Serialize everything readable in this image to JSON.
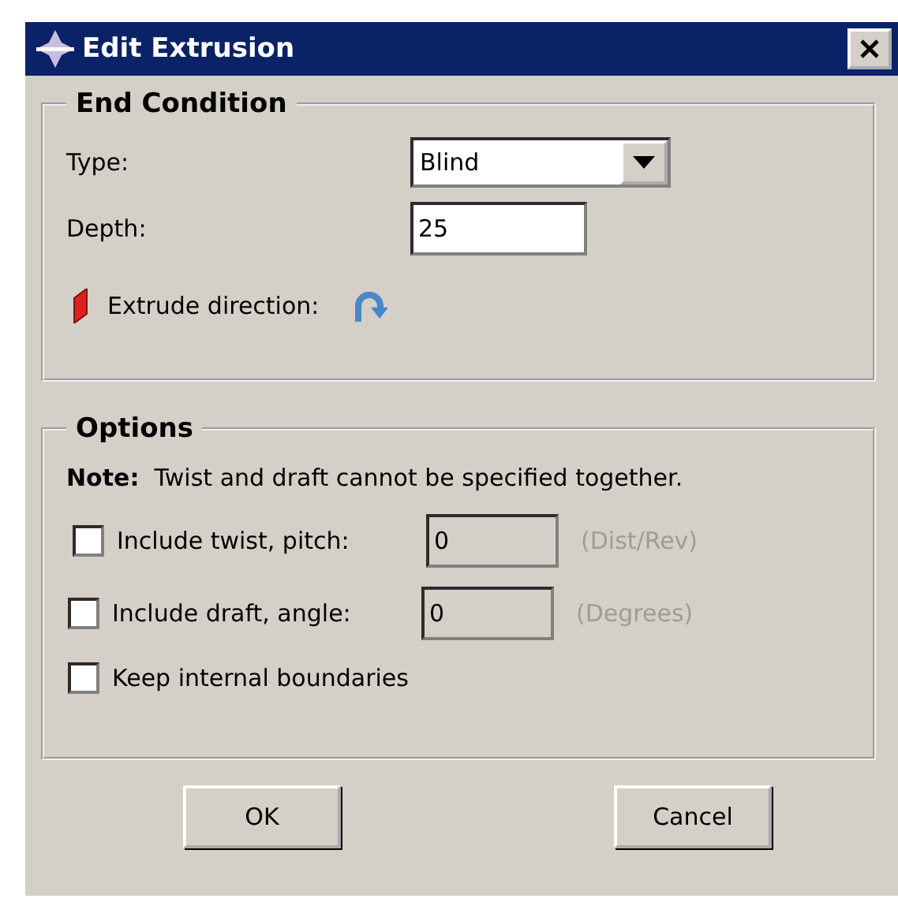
{
  "window": {
    "title": "Edit Extrusion"
  },
  "end_condition": {
    "title": "End Condition",
    "type": {
      "label": "Type:",
      "value": "Blind"
    },
    "depth": {
      "label": "Depth:",
      "value": "25"
    },
    "direction": {
      "label": "Extrude direction:"
    }
  },
  "options": {
    "title": "Options",
    "note": "**Note:**  Twist and draft cannot be specified together.",
    "checks": [
      {
        "kind": "field",
        "label": "Include twist, pitch:",
        "checked": false,
        "value": "0",
        "unit": "(Dist/Rev)",
        "disabled": true
      },
      {
        "kind": "field",
        "label": "Include draft, angle:",
        "checked": false,
        "value": "0",
        "unit": "(Degrees)",
        "disabled": true
      },
      {
        "kind": "plain",
        "label": "Keep internal boundaries",
        "checked": false
      }
    ]
  },
  "buttons": [
    {
      "label": "OK"
    },
    {
      "label": "Cancel"
    }
  ]
}
